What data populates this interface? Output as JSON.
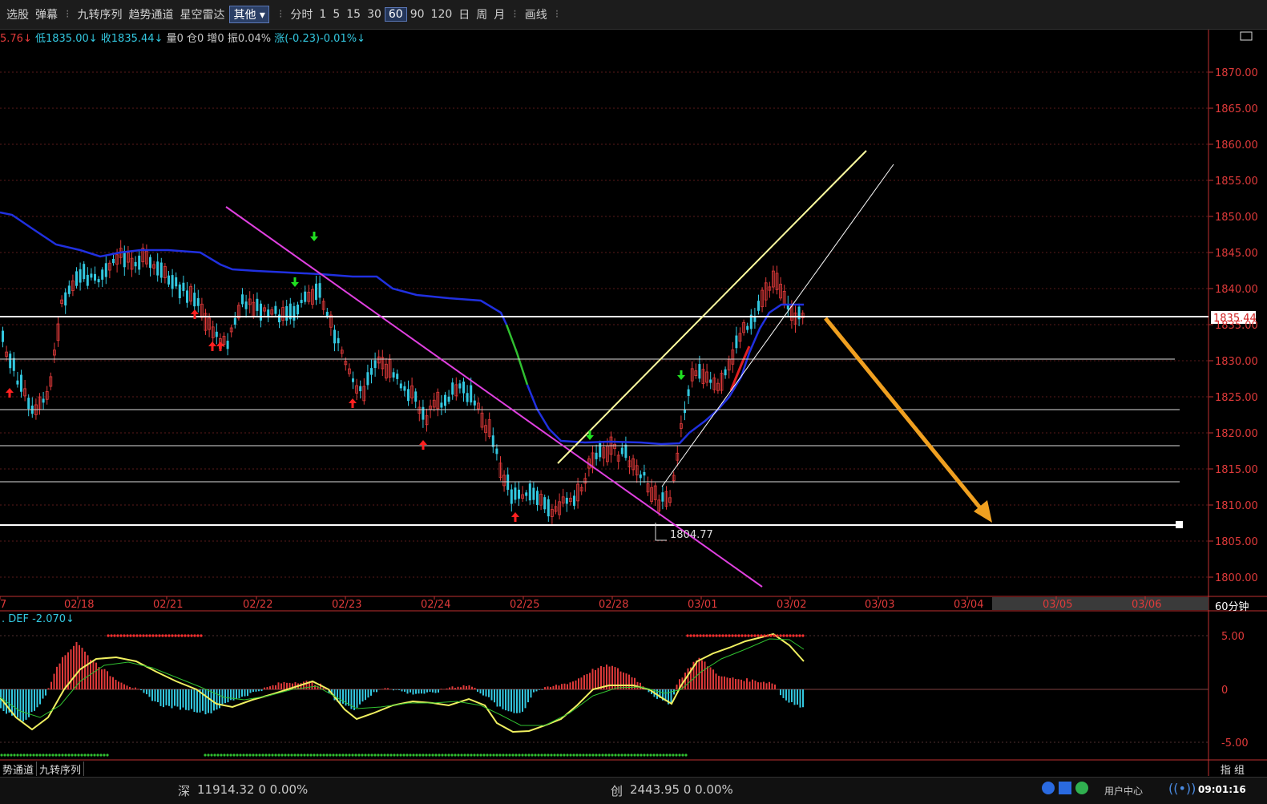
{
  "toolbar": {
    "items": [
      "选股",
      "弹幕",
      "九转序列",
      "趋势通道",
      "星空雷达"
    ],
    "dropdown": "其他",
    "periods": [
      "分时",
      "1",
      "5",
      "15",
      "30",
      "60",
      "90",
      "120",
      "日",
      "周",
      "月"
    ],
    "selected_period": "60",
    "draw": "画线"
  },
  "info": {
    "high_prefix": "5.76↓",
    "low": "低1835.00↓",
    "close": "收1835.44↓",
    "vol": "量0",
    "pos": "仓0",
    "inc": "增0",
    "amp": "振0.04%",
    "chg": "涨(-0.23)-0.01%↓"
  },
  "price_axis": {
    "ticks": [
      "1870.00",
      "1865.00",
      "1860.00",
      "1855.00",
      "1850.00",
      "1845.00",
      "1840.00",
      "1835.00",
      "1830.00",
      "1825.00",
      "1820.00",
      "1815.00",
      "1810.00",
      "1805.00",
      "1800.00"
    ],
    "current": "1835.44"
  },
  "date_axis": [
    "7",
    "02/18",
    "02/21",
    "02/22",
    "02/23",
    "02/24",
    "02/25",
    "02/28",
    "03/01",
    "03/02",
    "03/03",
    "03/04",
    "03/05",
    "03/06"
  ],
  "period_label": "60分钟",
  "low_marker": "1804.77",
  "indicator": {
    "label": ". DEF -2.070↓",
    "ticks": [
      "5.00",
      "0",
      "-5.00"
    ]
  },
  "tabs": [
    "势通道",
    "九转序列"
  ],
  "right_tabs": "指 组",
  "status": {
    "shen_name": "深",
    "shen": "11914.32  0  0.00%",
    "chuang_name": "创",
    "chuang": "2443.95  0  0.00%",
    "user_center": "用户中心",
    "time": "09:01:16"
  },
  "colors": {
    "up": "#e03a3a",
    "down": "#33c8e0",
    "ma": "#2030e0",
    "trend": "#ffffa0",
    "magenta": "#e040e0",
    "arrow": "#f0a020"
  }
}
